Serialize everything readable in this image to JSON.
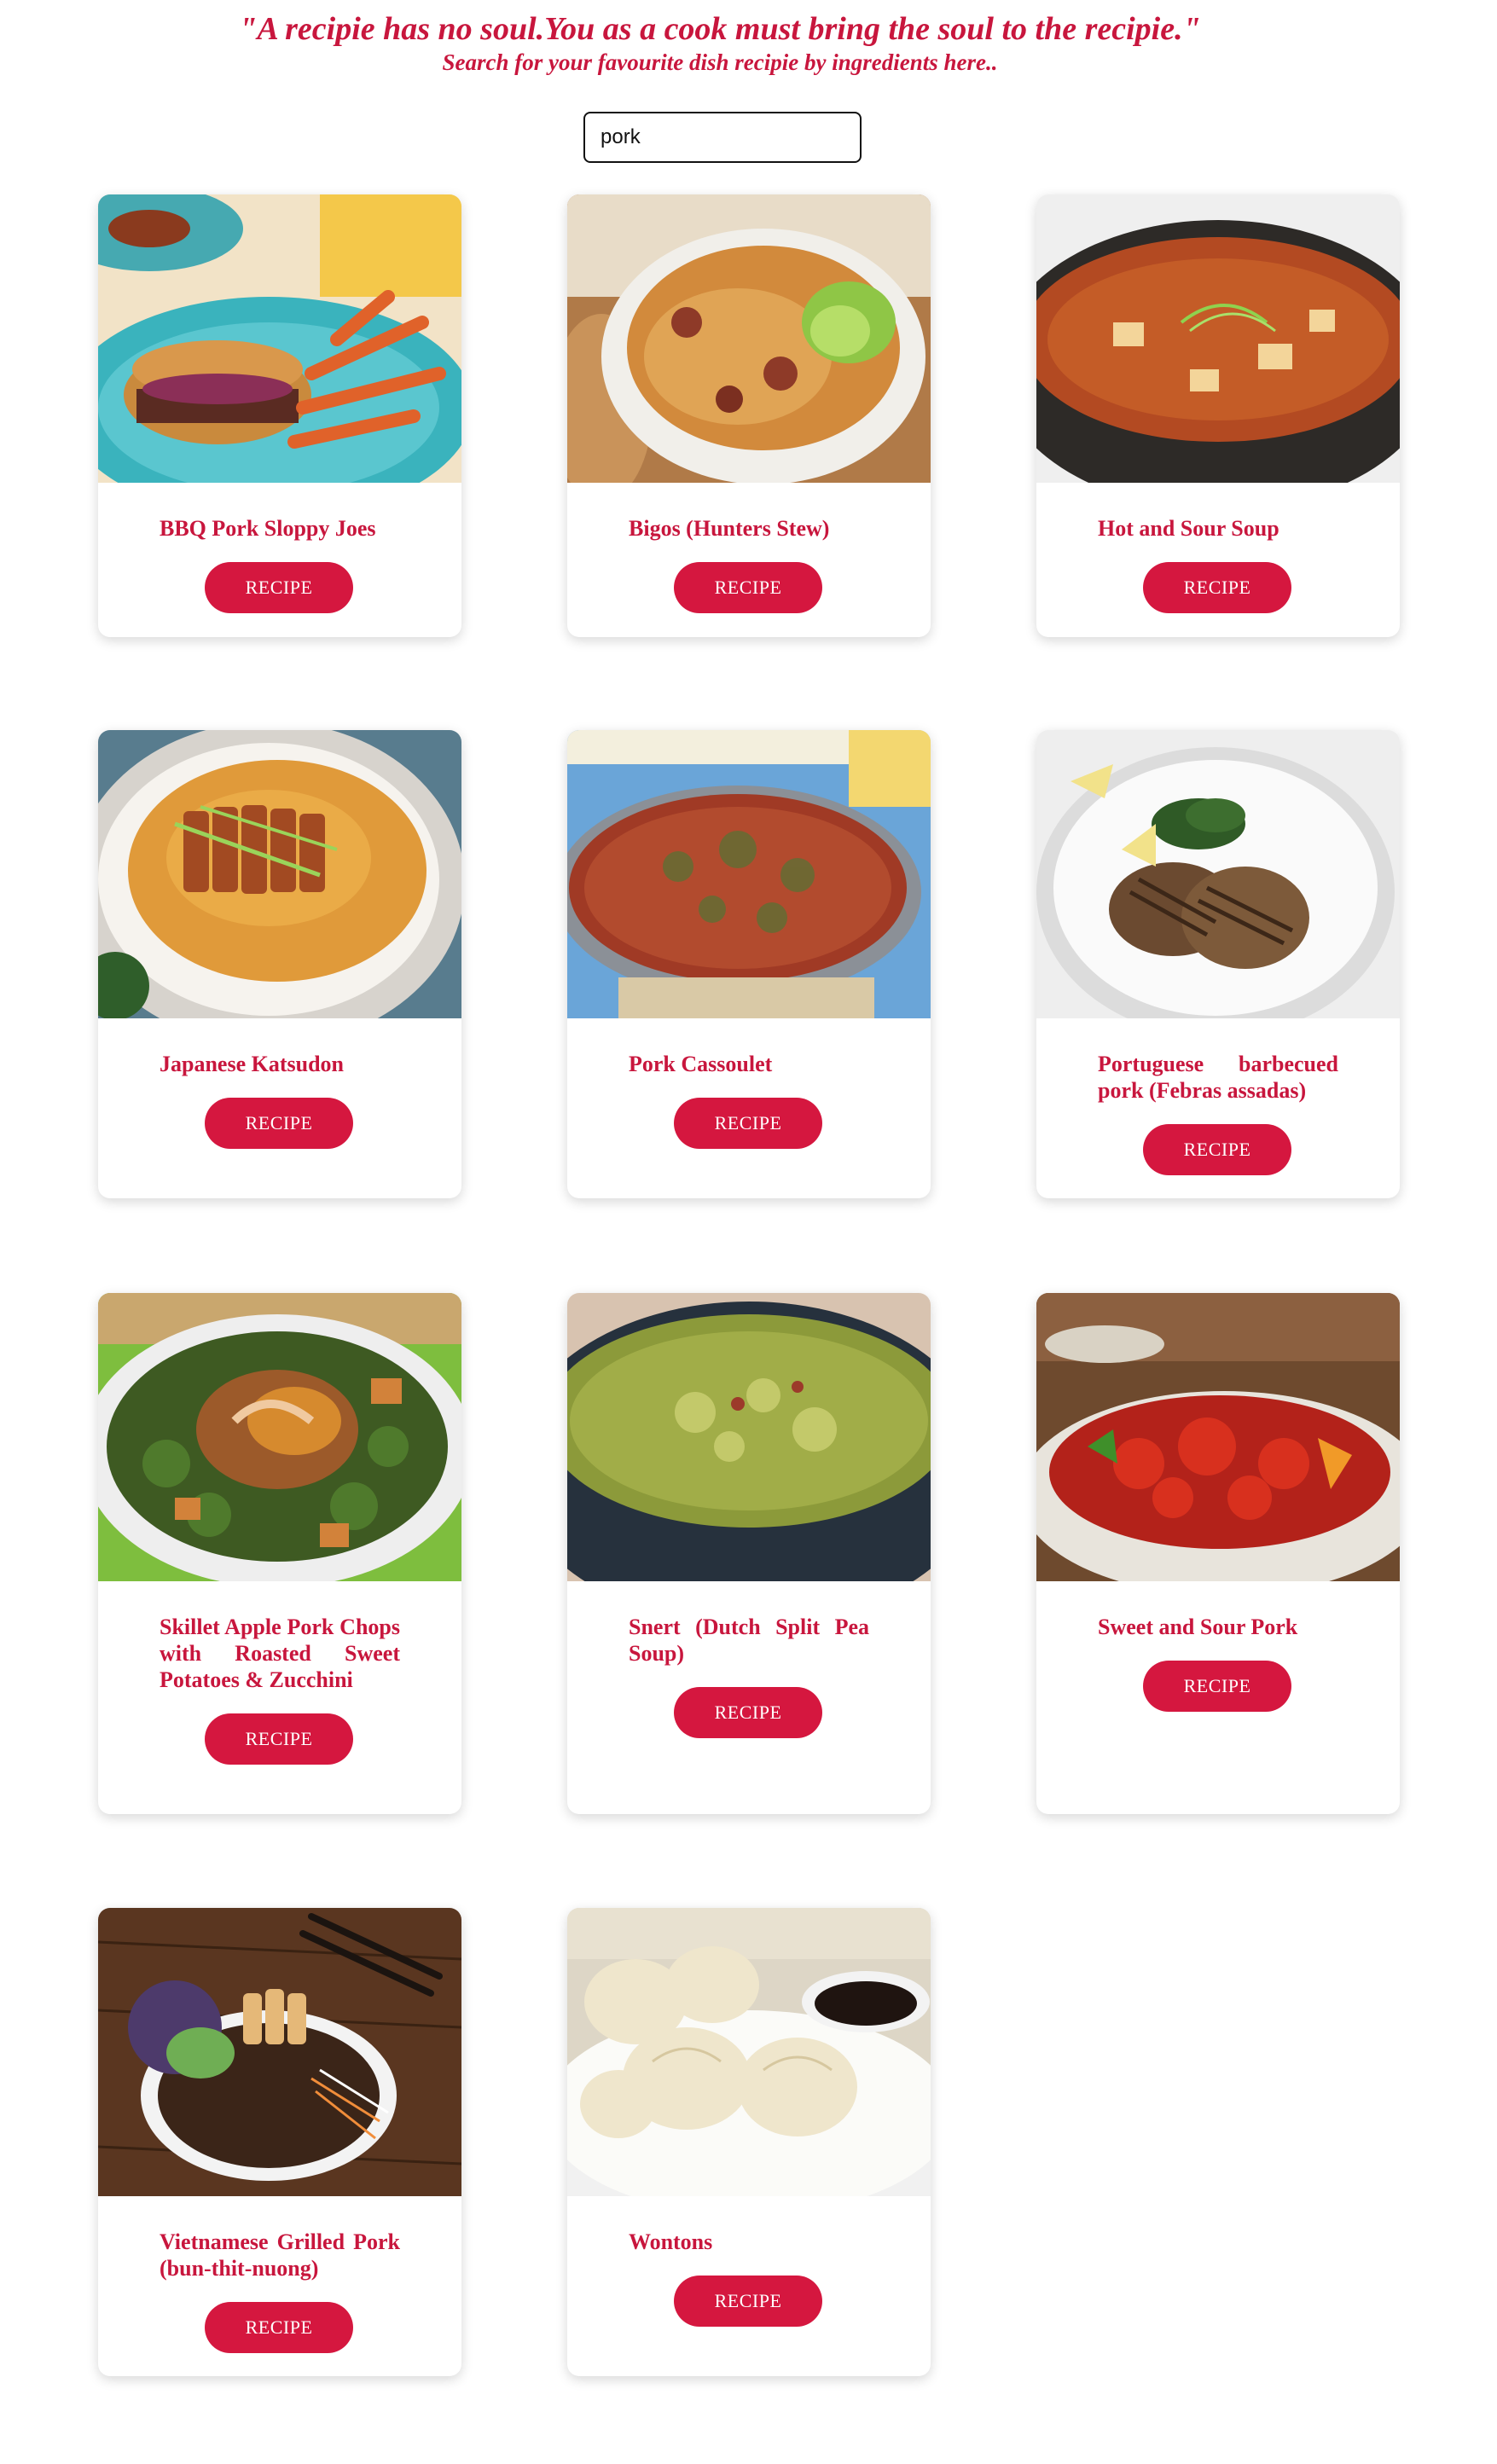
{
  "header": {
    "quote": "\"A recipie has no soul.You as a cook must bring the soul to the recipie.\"",
    "subtitle": "Search for your favourite dish recipie by ingredients here.."
  },
  "search": {
    "value": "pork",
    "button_icon": "search-icon"
  },
  "theme": {
    "accent": "#d5173f",
    "text": "#c8163d"
  },
  "recipes": [
    {
      "title": "BBQ Pork Sloppy Joes",
      "button": "RECIPE"
    },
    {
      "title": "Bigos (Hunters Stew)",
      "button": "RECIPE"
    },
    {
      "title": "Hot and Sour Soup",
      "button": "RECIPE"
    },
    {
      "title": "Japanese Katsudon",
      "button": "RECIPE"
    },
    {
      "title": "Pork Cassoulet",
      "button": "RECIPE"
    },
    {
      "title": "Portuguese barbecued pork (Febras assadas)",
      "button": "RECIPE"
    },
    {
      "title": "Skillet Apple Pork Chops with Roasted Sweet Potatoes & Zucchini",
      "button": "RECIPE"
    },
    {
      "title": "Snert (Dutch Split Pea Soup)",
      "button": "RECIPE"
    },
    {
      "title": "Sweet and Sour Pork",
      "button": "RECIPE"
    },
    {
      "title": "Vietnamese Grilled Pork (bun-thit-nuong)",
      "button": "RECIPE"
    },
    {
      "title": "Wontons",
      "button": "RECIPE"
    }
  ]
}
